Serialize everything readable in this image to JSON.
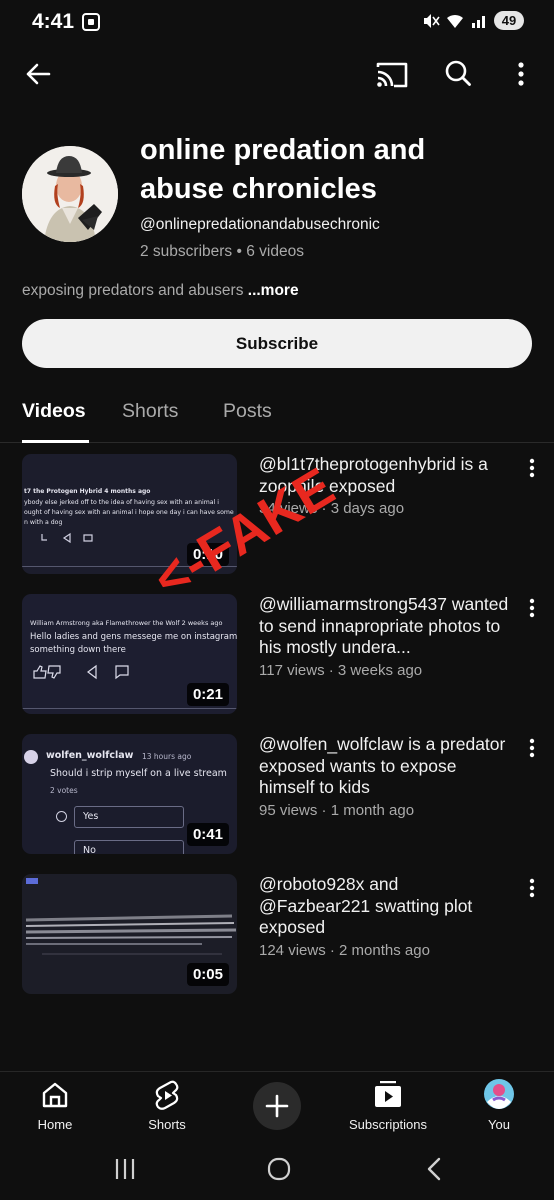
{
  "status_bar": {
    "time": "4:41",
    "battery": "49"
  },
  "channel": {
    "name": "online predation and abuse chronicles",
    "handle": "@onlinepredationandabusechronic",
    "stats": "2 subscribers • 6 videos",
    "description": "exposing predators and abusers",
    "more_label": "...more",
    "subscribe_label": "Subscribe"
  },
  "tabs": [
    {
      "label": "Videos",
      "active": true
    },
    {
      "label": "Shorts",
      "active": false
    },
    {
      "label": "Posts",
      "active": false
    }
  ],
  "annotation": {
    "text": "<-FAKE",
    "color": "#e8281f"
  },
  "videos": [
    {
      "title": "@bl1t7theprotogenhybrid is a zoophile exposed",
      "meta": "34 views · 3 days ago",
      "duration": "0:10",
      "thumb": {
        "lines": [
          "t7 the Protogen Hybrid  4 months ago",
          "ybody else jerked off to the idea of having sex with an animal i",
          "ought of having sex with an animal i hope one day i can have some",
          "n with a dog"
        ]
      }
    },
    {
      "title": "@williamarmstrong5437 wanted to send innapropriate photos to his mostly undera...",
      "meta": "117 views · 3 weeks ago",
      "duration": "0:21",
      "thumb": {
        "lines": [
          "William Armstrong aka Flamethrower the Wolf  2 weeks ago",
          "Hello ladies and gens messege me on instagram",
          "something down there"
        ]
      }
    },
    {
      "title": "@wolfen_wolfclaw  is a predator exposed wants to expose himself to kids",
      "meta": "95 views · 1 month ago",
      "duration": "0:41",
      "thumb": {
        "lines": [
          "wolfen_wolfclaw",
          "13 hours ago",
          "Should i strip myself on a live stream",
          "2 votes",
          "Yes",
          "No"
        ]
      }
    },
    {
      "title": "@roboto928x and @Fazbear221 swatting plot exposed",
      "meta": "124 views · 2 months ago",
      "duration": "0:05",
      "thumb": {
        "lines": []
      }
    }
  ],
  "bottom_nav": [
    {
      "label": "Home"
    },
    {
      "label": "Shorts"
    },
    {
      "label": "Subscriptions"
    },
    {
      "label": "You"
    }
  ]
}
